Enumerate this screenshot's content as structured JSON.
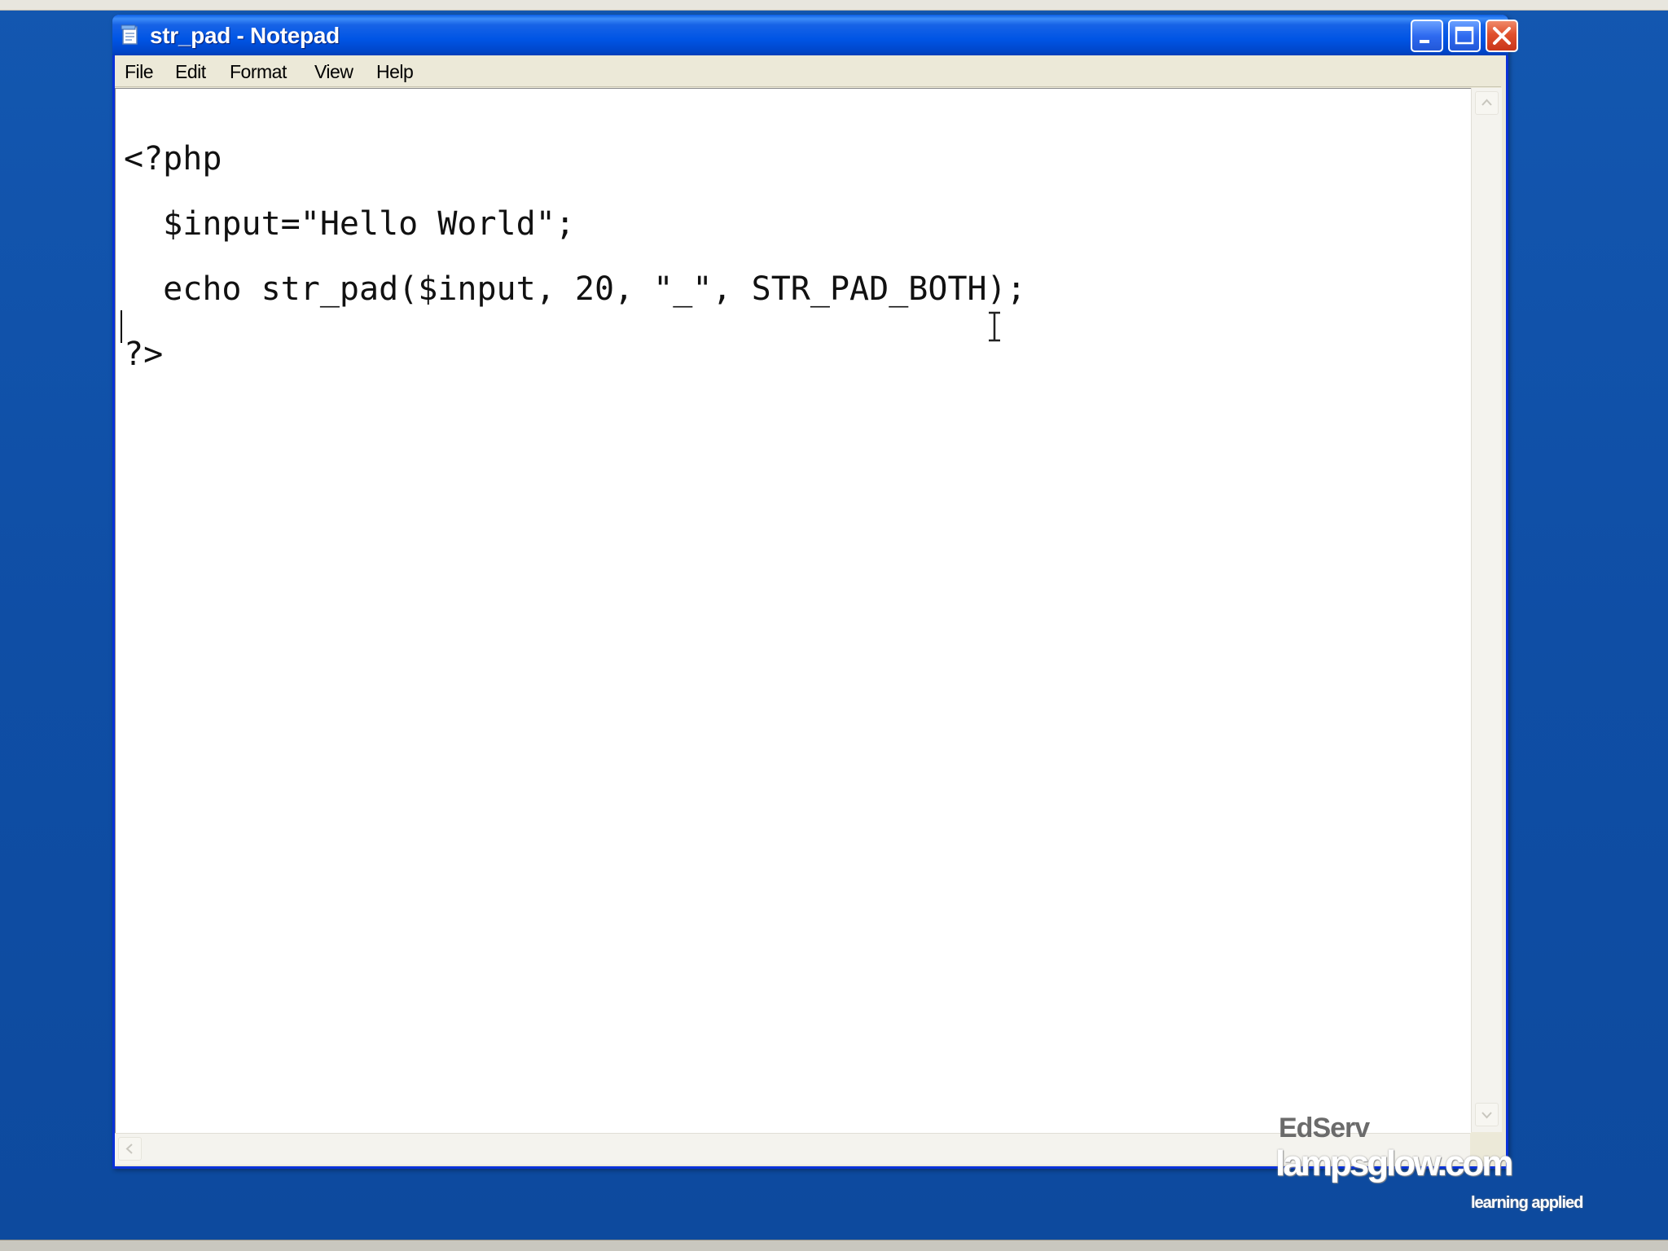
{
  "window": {
    "title": "str_pad - Notepad",
    "app_icon": "notepad-icon",
    "controls": [
      "minimize-icon",
      "maximize-icon",
      "close-icon"
    ]
  },
  "menu": {
    "file": "File",
    "edit": "Edit",
    "format": "Format",
    "view": "View",
    "help": "Help"
  },
  "editor": {
    "lines": [
      "<?php",
      "  $input=\"Hello World\";",
      "  echo str_pad($input, 20, \"_\", STR_PAD_BOTH);",
      "?>"
    ]
  },
  "watermark": {
    "brand": "EdServ",
    "site": "lampsglow.com",
    "tagline": "learning applied"
  },
  "colors": {
    "desktop": "#1151a8",
    "titlebar": "#0055e5",
    "close_button": "#e0502c",
    "window_frame": "#ece9d8"
  }
}
